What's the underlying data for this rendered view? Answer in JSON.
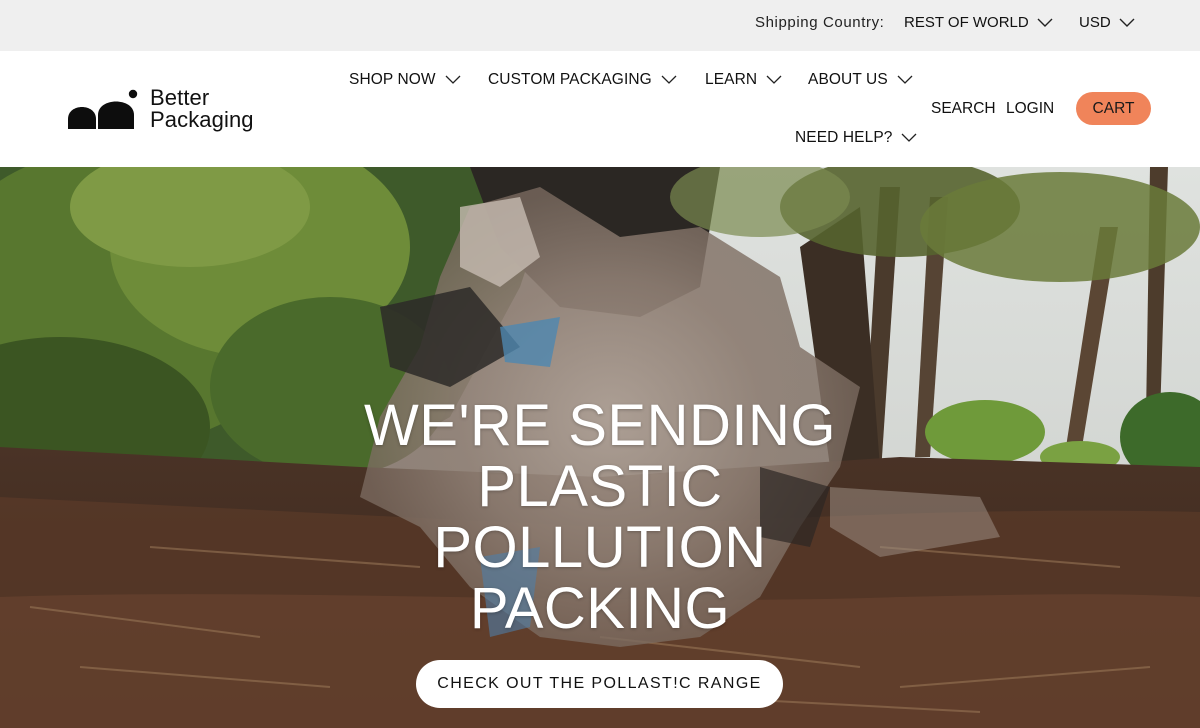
{
  "topbar": {
    "shipping_label": "Shipping Country:",
    "shipping_value": "REST OF WORLD",
    "currency": "USD"
  },
  "brand": {
    "line1": "Better",
    "line2": "Packaging"
  },
  "nav": {
    "shop": "SHOP NOW",
    "custom": "CUSTOM PACKAGING",
    "learn": "LEARN",
    "about": "ABOUT US",
    "help": "NEED HELP?"
  },
  "utility": {
    "search": "SEARCH",
    "login": "LOGIN",
    "cart": "CART"
  },
  "hero": {
    "title_lines": [
      "WE'RE SENDING",
      "PLASTIC",
      "POLLUTION",
      "PACKING"
    ],
    "cta": "CHECK OUT THE POLLAST!C RANGE"
  },
  "colors": {
    "accent": "#f0845a",
    "topbar_bg": "#efefef"
  },
  "icons": {
    "dropdown": "chevron-down-icon",
    "logo": "better-packaging-logo-icon"
  }
}
